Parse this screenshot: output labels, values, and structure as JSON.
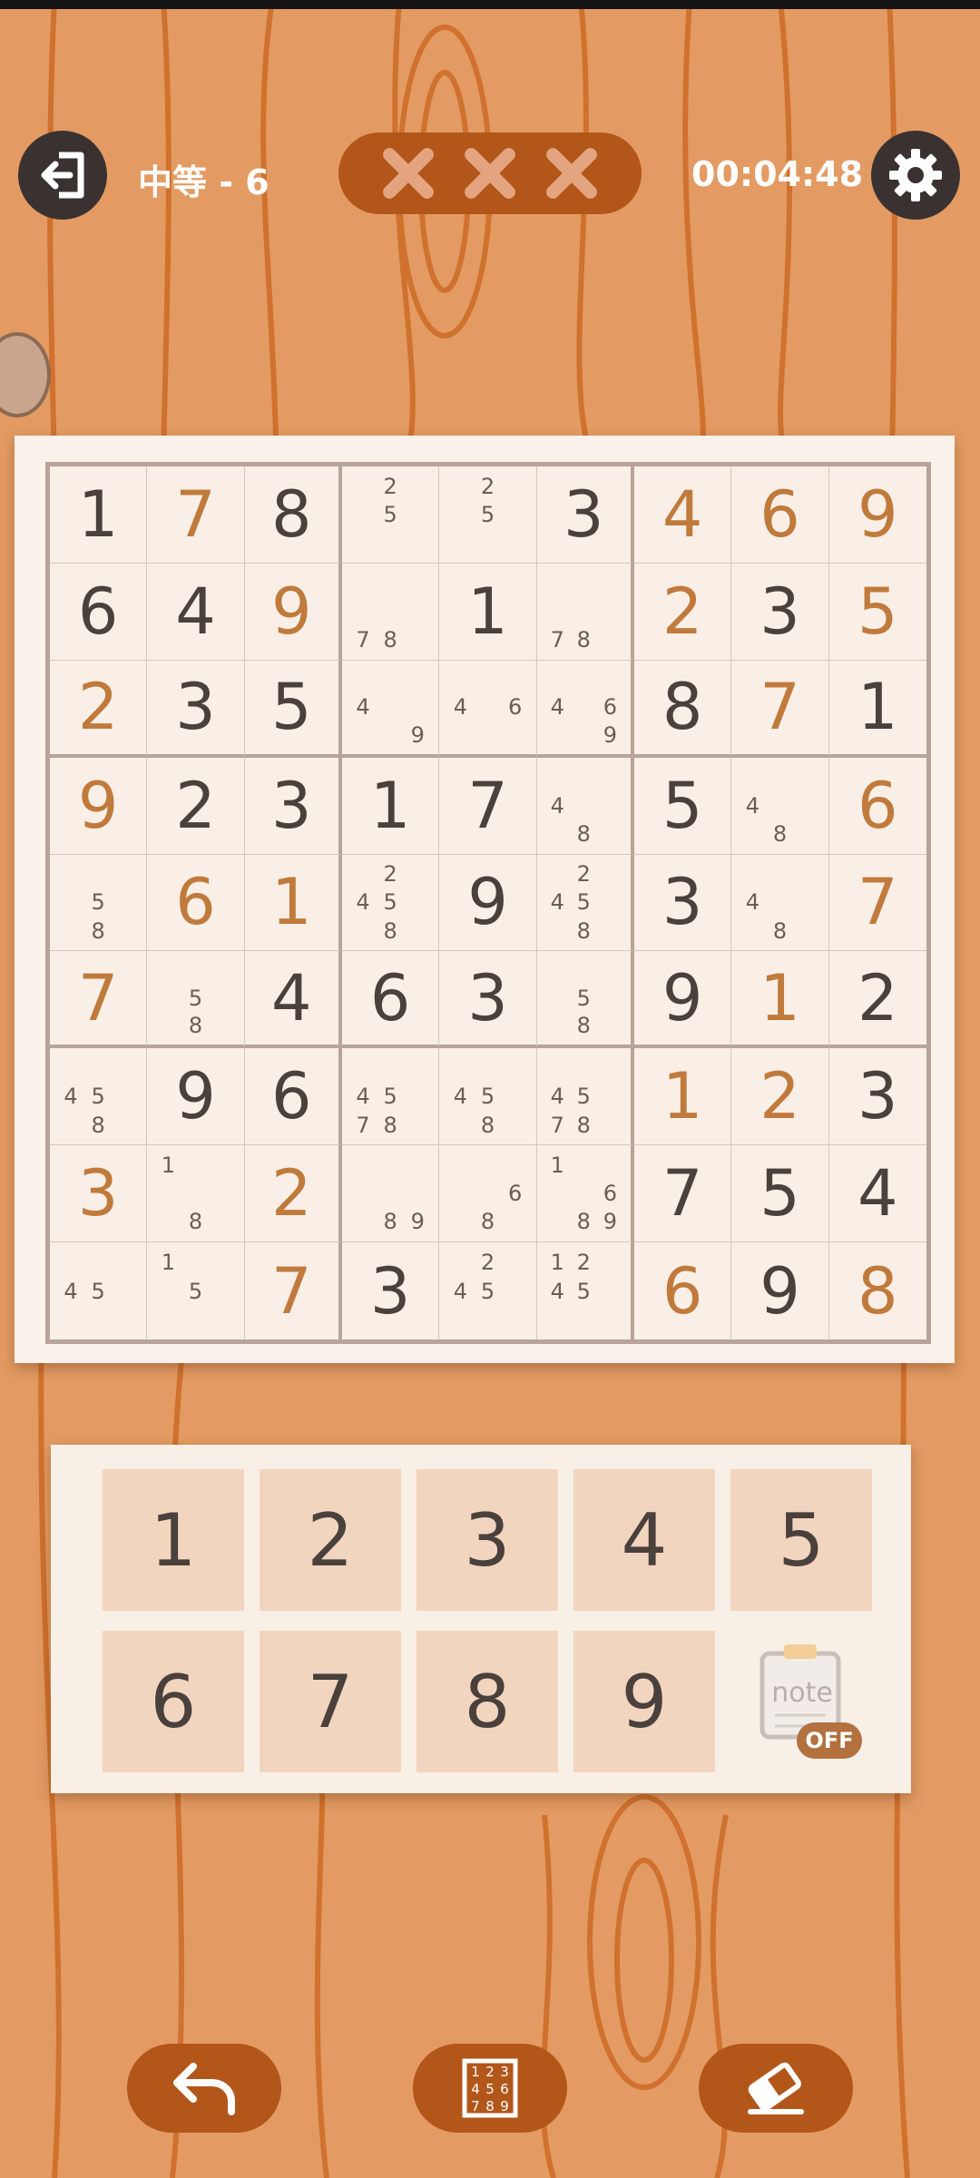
{
  "header": {
    "difficulty": "中等 - 6",
    "timer": "00:04:48",
    "mistakes": [
      "close-icon",
      "close-icon",
      "close-icon"
    ],
    "icons": {
      "back": "exit-icon",
      "settings": "gear-icon"
    }
  },
  "board": {
    "rows": [
      [
        {
          "v": "1",
          "t": "given"
        },
        {
          "v": "7",
          "t": "filled"
        },
        {
          "v": "8",
          "t": "given"
        },
        {
          "n": [
            "2",
            "5"
          ]
        },
        {
          "n": [
            "2",
            "5"
          ]
        },
        {
          "v": "3",
          "t": "given"
        },
        {
          "v": "4",
          "t": "filled"
        },
        {
          "v": "6",
          "t": "filled"
        },
        {
          "v": "9",
          "t": "filled"
        }
      ],
      [
        {
          "v": "6",
          "t": "given"
        },
        {
          "v": "4",
          "t": "given"
        },
        {
          "v": "9",
          "t": "filled"
        },
        {
          "n": [
            "7",
            "8"
          ]
        },
        {
          "v": "1",
          "t": "given"
        },
        {
          "n": [
            "7",
            "8"
          ]
        },
        {
          "v": "2",
          "t": "filled"
        },
        {
          "v": "3",
          "t": "given"
        },
        {
          "v": "5",
          "t": "filled"
        }
      ],
      [
        {
          "v": "2",
          "t": "filled"
        },
        {
          "v": "3",
          "t": "given"
        },
        {
          "v": "5",
          "t": "given"
        },
        {
          "n": [
            "4",
            "9"
          ]
        },
        {
          "n": [
            "4",
            "6"
          ]
        },
        {
          "n": [
            "4",
            "6",
            "9"
          ]
        },
        {
          "v": "8",
          "t": "given"
        },
        {
          "v": "7",
          "t": "filled"
        },
        {
          "v": "1",
          "t": "given"
        }
      ],
      [
        {
          "v": "9",
          "t": "filled"
        },
        {
          "v": "2",
          "t": "given"
        },
        {
          "v": "3",
          "t": "given"
        },
        {
          "v": "1",
          "t": "given"
        },
        {
          "v": "7",
          "t": "given"
        },
        {
          "n": [
            "4",
            "8"
          ]
        },
        {
          "v": "5",
          "t": "given"
        },
        {
          "n": [
            "4",
            "8"
          ]
        },
        {
          "v": "6",
          "t": "filled"
        }
      ],
      [
        {
          "n": [
            "5",
            "8"
          ]
        },
        {
          "v": "6",
          "t": "filled"
        },
        {
          "v": "1",
          "t": "filled"
        },
        {
          "n": [
            "2",
            "4",
            "5",
            "8"
          ]
        },
        {
          "v": "9",
          "t": "given"
        },
        {
          "n": [
            "2",
            "4",
            "5",
            "8"
          ]
        },
        {
          "v": "3",
          "t": "given"
        },
        {
          "n": [
            "4",
            "8"
          ]
        },
        {
          "v": "7",
          "t": "filled"
        }
      ],
      [
        {
          "v": "7",
          "t": "filled"
        },
        {
          "n": [
            "5",
            "8"
          ]
        },
        {
          "v": "4",
          "t": "given"
        },
        {
          "v": "6",
          "t": "given"
        },
        {
          "v": "3",
          "t": "given"
        },
        {
          "n": [
            "5",
            "8"
          ]
        },
        {
          "v": "9",
          "t": "given"
        },
        {
          "v": "1",
          "t": "filled"
        },
        {
          "v": "2",
          "t": "given"
        }
      ],
      [
        {
          "n": [
            "4",
            "5",
            "8"
          ]
        },
        {
          "v": "9",
          "t": "given"
        },
        {
          "v": "6",
          "t": "given"
        },
        {
          "n": [
            "4",
            "5",
            "7",
            "8"
          ]
        },
        {
          "n": [
            "4",
            "5",
            "8"
          ]
        },
        {
          "n": [
            "4",
            "5",
            "7",
            "8"
          ]
        },
        {
          "v": "1",
          "t": "filled"
        },
        {
          "v": "2",
          "t": "filled"
        },
        {
          "v": "3",
          "t": "given"
        }
      ],
      [
        {
          "v": "3",
          "t": "filled"
        },
        {
          "n": [
            "1",
            "8"
          ]
        },
        {
          "v": "2",
          "t": "filled"
        },
        {
          "n": [
            "8",
            "9"
          ]
        },
        {
          "n": [
            "6",
            "8"
          ]
        },
        {
          "n": [
            "1",
            "6",
            "8",
            "9"
          ]
        },
        {
          "v": "7",
          "t": "given"
        },
        {
          "v": "5",
          "t": "given"
        },
        {
          "v": "4",
          "t": "given"
        }
      ],
      [
        {
          "n": [
            "4",
            "5"
          ]
        },
        {
          "n": [
            "1",
            "5"
          ]
        },
        {
          "v": "7",
          "t": "filled"
        },
        {
          "v": "3",
          "t": "given"
        },
        {
          "n": [
            "2",
            "4",
            "5"
          ]
        },
        {
          "n": [
            "1",
            "2",
            "4",
            "5"
          ]
        },
        {
          "v": "6",
          "t": "filled"
        },
        {
          "v": "9",
          "t": "given"
        },
        {
          "v": "8",
          "t": "filled"
        }
      ]
    ]
  },
  "pad": {
    "keys": [
      "1",
      "2",
      "3",
      "4",
      "5",
      "6",
      "7",
      "8",
      "9"
    ],
    "note_label": "note",
    "note_state": "OFF"
  },
  "bottom": {
    "icons": [
      "undo-icon",
      "number-grid-icon",
      "eraser-icon"
    ]
  },
  "colors": {
    "background": "#e39b63",
    "accent": "#b2561a",
    "given_digit": "#4a403c",
    "filled_digit": "#c07a3c"
  }
}
